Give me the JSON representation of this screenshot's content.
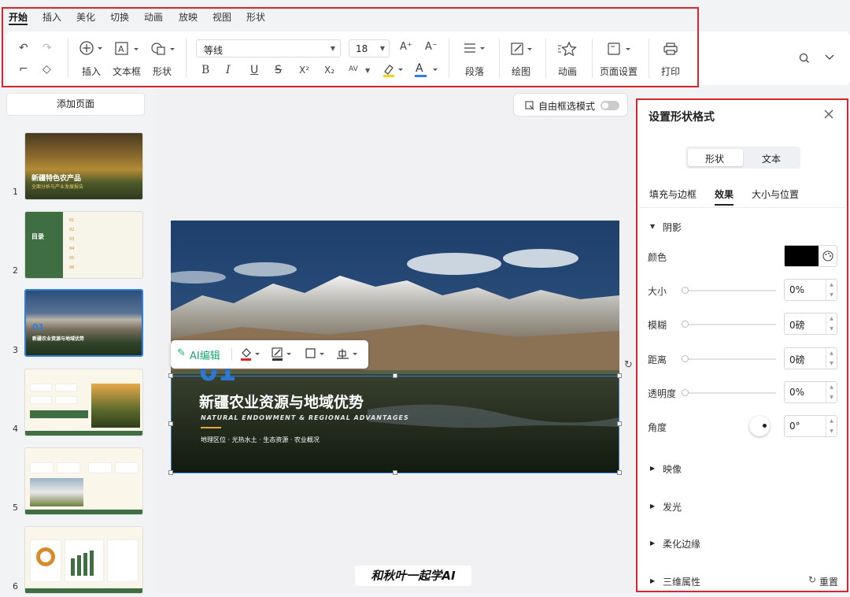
{
  "menu": {
    "tabs": [
      "开始",
      "插入",
      "美化",
      "切换",
      "动画",
      "放映",
      "视图",
      "形状"
    ],
    "active": "开始"
  },
  "ribbon": {
    "insert_label": "插入",
    "textbox_label": "文本框",
    "shape_label": "形状",
    "font_name": "等线",
    "font_size": "18",
    "paragraph_label": "段落",
    "draw_label": "绘图",
    "animation_label": "动画",
    "page_setup_label": "页面设置",
    "print_label": "打印",
    "bold": "B",
    "italic": "I",
    "underline": "U",
    "strike": "S",
    "superscript": "X²",
    "subscript": "X₂",
    "char_spacing": "AV",
    "font_color_glyph": "A",
    "grow_font": "A⁺",
    "shrink_font": "A⁻"
  },
  "left_panel": {
    "add_page_label": "添加页面",
    "slides": [
      {
        "num": "1",
        "title": "新疆特色农产品",
        "subtitle": "全面分析与产业发展报告"
      },
      {
        "num": "2",
        "title": "目录",
        "items": [
          "01",
          "02",
          "03",
          "04",
          "05",
          "06"
        ]
      },
      {
        "num": "3",
        "title": "新疆农业资源与地域优势",
        "big": "01"
      },
      {
        "num": "4"
      },
      {
        "num": "5"
      },
      {
        "num": "6"
      }
    ]
  },
  "canvas": {
    "free_select_label": "自由框选模式",
    "ai_edit_label": "AI编辑",
    "slide_title": "新疆农业资源与地域优势",
    "slide_subtitle": "NATURAL ENDOWMENT & REGIONAL ADVANTAGES",
    "slide_tags": "地理区位 · 光热水土 · 生态资源 · 农业概况",
    "slide_number": "01",
    "watermark": "和秋叶一起学AI"
  },
  "format_panel": {
    "title": "设置形状格式",
    "toggle": [
      "形状",
      "文本"
    ],
    "toggle_active": "形状",
    "tabs": [
      "填充与边框",
      "效果",
      "大小与位置"
    ],
    "active_tab": "效果",
    "shadow_section": "阴影",
    "color_label": "颜色",
    "color_value": "#000000",
    "size_label": "大小",
    "size_value": "0%",
    "blur_label": "模糊",
    "blur_value": "0磅",
    "distance_label": "距离",
    "distance_value": "0磅",
    "transparency_label": "透明度",
    "transparency_value": "0%",
    "angle_label": "角度",
    "angle_value": "0°",
    "sections": [
      "映像",
      "发光",
      "柔化边缘",
      "三维属性"
    ],
    "reset_label": "重置"
  },
  "colors": {
    "accent_red": "#d9252b",
    "selection_blue": "#2f7de1",
    "ai_green": "#19a974",
    "slide_gold": "#e2a93b"
  }
}
